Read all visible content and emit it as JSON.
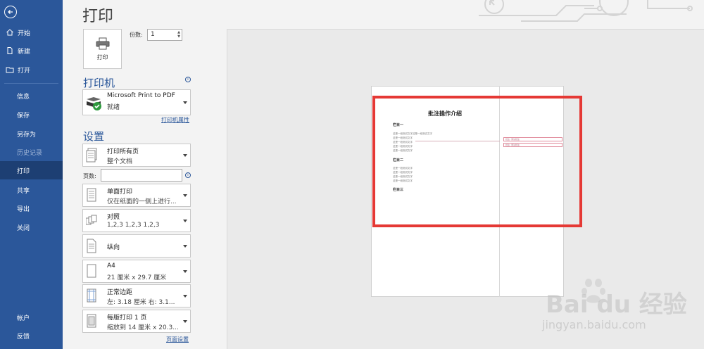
{
  "sidebar": {
    "items": [
      {
        "label": "开始",
        "icon": "home-icon"
      },
      {
        "label": "新建",
        "icon": "new-document-icon"
      },
      {
        "label": "打开",
        "icon": "folder-open-icon"
      },
      {
        "label": "信息"
      },
      {
        "label": "保存"
      },
      {
        "label": "另存为"
      },
      {
        "label": "历史记录"
      },
      {
        "label": "打印"
      },
      {
        "label": "共享"
      },
      {
        "label": "导出"
      },
      {
        "label": "关闭"
      },
      {
        "label": "帐户"
      },
      {
        "label": "反馈"
      }
    ],
    "active": "打印"
  },
  "page": {
    "title": "打印"
  },
  "print": {
    "button_label": "打印",
    "copies_label": "份数:",
    "copies_value": "1"
  },
  "printer": {
    "section_title": "打印机",
    "name": "Microsoft Print to PDF",
    "status": "就绪",
    "properties_link": "打印机属性"
  },
  "settings": {
    "section_title": "设置",
    "pages_label": "页数:",
    "pages_value": "",
    "options": [
      {
        "line1": "打印所有页",
        "line2": "整个文档"
      },
      {
        "line1": "单面打印",
        "line2": "仅在纸面的一侧上进行..."
      },
      {
        "line1": "对照",
        "line2": "1,2,3    1,2,3    1,2,3"
      },
      {
        "line1": "纵向",
        "line2": ""
      },
      {
        "line1": "A4",
        "line2": "21 厘米 x 29.7 厘米"
      },
      {
        "line1": "正常边距",
        "line2": "左: 3.18 厘米    右: 3.1..."
      },
      {
        "line1": "每版打印 1 页",
        "line2": "缩放到 14 厘米 x 20.3..."
      }
    ],
    "page_setup_link": "页面设置"
  },
  "preview": {
    "doc_title": "批注操作介绍",
    "headings": [
      "栏目一",
      "栏目二",
      "栏目三"
    ],
    "lines_block1": [
      "这是一段测试文字这是一段测试文字",
      "这是一段测试文字",
      "这是一段测试文字",
      "这是一段测试文字",
      "这是一段测试文字"
    ],
    "lines_block2": [
      "这是一段测试文字",
      "这是一段测试文字",
      "这是一段测试文字",
      "这是一段测试文字"
    ],
    "comments": [
      "批注: 测试批注",
      "批注: 测试批注"
    ]
  },
  "watermark": {
    "text": "Bai du 经验",
    "url": "jingyan.baidu.com"
  },
  "colors": {
    "sidebar": "#2b579a",
    "accent": "#2b579a",
    "highlight": "#e53935"
  }
}
